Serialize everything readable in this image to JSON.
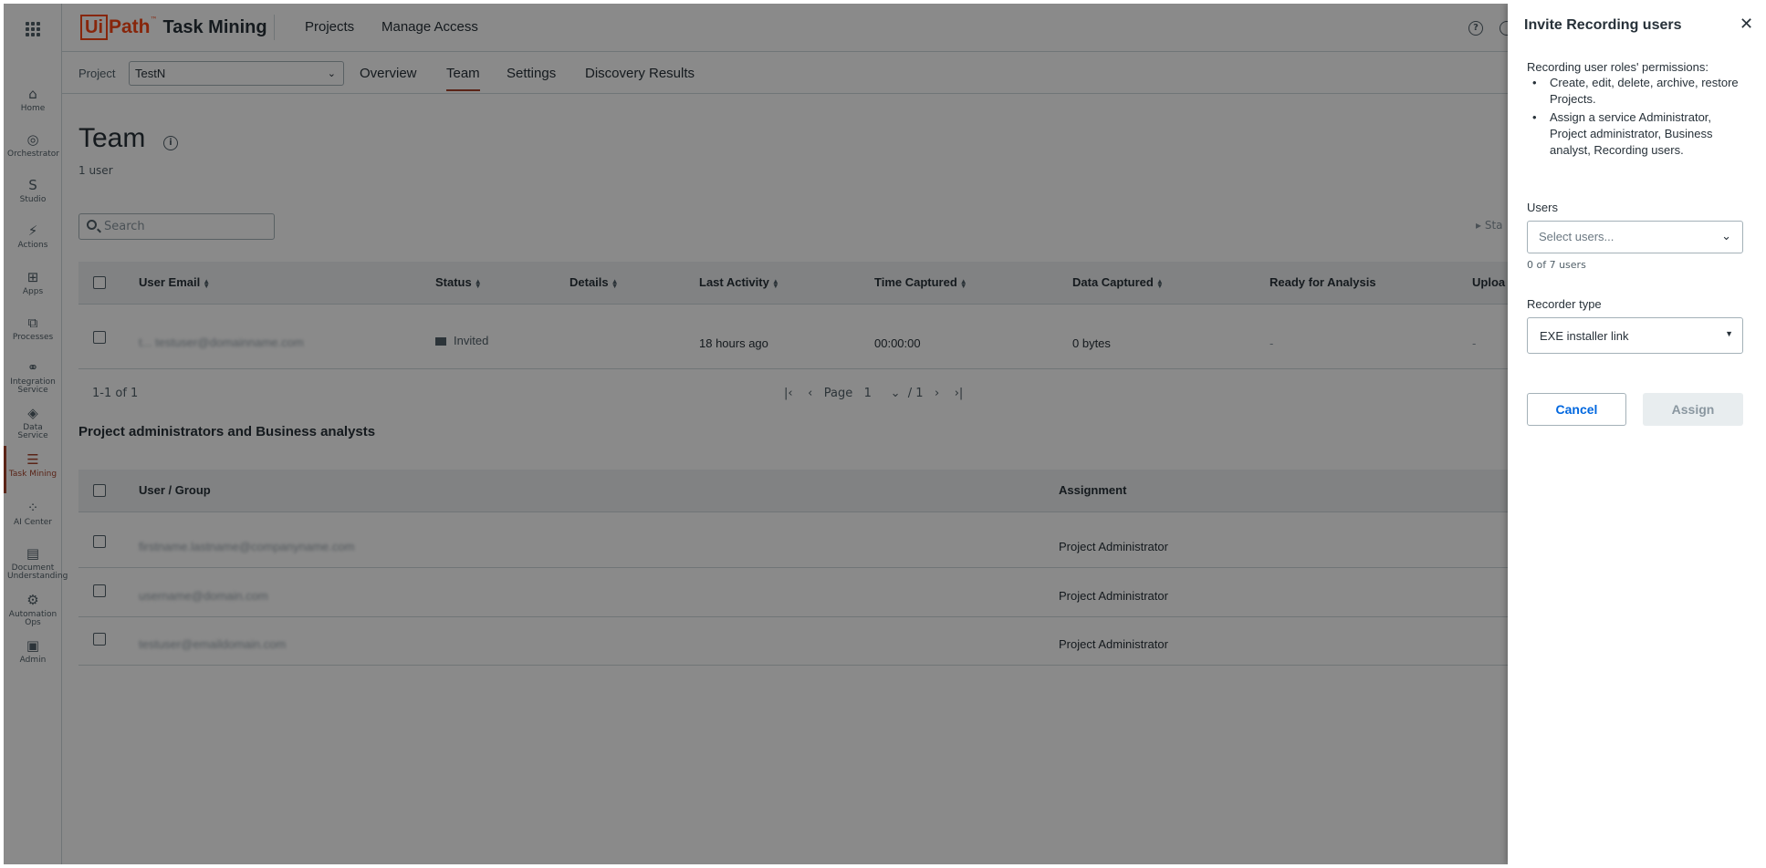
{
  "rail": {
    "items": [
      {
        "label": "Home",
        "icon": "home-icon"
      },
      {
        "label": "Orchestrator",
        "icon": "orchestrator-icon"
      },
      {
        "label": "Studio",
        "icon": "studio-icon"
      },
      {
        "label": "Actions",
        "icon": "actions-icon"
      },
      {
        "label": "Apps",
        "icon": "apps-icon"
      },
      {
        "label": "Processes",
        "icon": "processes-icon"
      },
      {
        "label": "Integration Service",
        "icon": "integration-service-icon"
      },
      {
        "label": "Data Service",
        "icon": "data-service-icon"
      },
      {
        "label": "Task Mining",
        "icon": "task-mining-icon"
      },
      {
        "label": "AI Center",
        "icon": "ai-center-icon"
      },
      {
        "label": "Document Understanding",
        "icon": "document-understanding-icon"
      },
      {
        "label": "Automation Ops",
        "icon": "automation-ops-icon"
      },
      {
        "label": "Admin",
        "icon": "admin-icon"
      }
    ],
    "active_color": "#a6432c"
  },
  "header": {
    "logo_ui": "Ui",
    "logo_path": "Path",
    "logo_tm": "™",
    "product": "Task Mining",
    "nav": [
      "Projects",
      "Manage Access"
    ],
    "help_glyph": "?"
  },
  "subheader": {
    "project_label": "Project",
    "project_value": "TestN",
    "tabs": [
      "Overview",
      "Team",
      "Settings",
      "Discovery Results"
    ],
    "active_tab": "Team"
  },
  "page": {
    "title": "Team",
    "user_count": "1 user",
    "search_placeholder": "Search",
    "status_truncated": "Sta"
  },
  "recording_table": {
    "columns": [
      "User Email",
      "Status",
      "Details",
      "Last Activity",
      "Time Captured",
      "Data Captured",
      "Ready for Analysis",
      "Uploa"
    ],
    "rows": [
      {
        "email": "t... testuser@domainname.com",
        "status": "Invited",
        "details": "",
        "last_activity": "18 hours ago",
        "time_captured": "00:00:00",
        "data_captured": "0 bytes",
        "ready": "-",
        "upload": "-"
      }
    ],
    "range": "1-1 of 1",
    "page_label": "Page",
    "page_value": "1",
    "page_total": "/ 1"
  },
  "admins_section": {
    "title": "Project administrators and Business analysts",
    "columns": [
      "User / Group",
      "Assignment"
    ],
    "rows": [
      {
        "user": "firstname.lastname@companyname.com",
        "assignment": "Project Administrator"
      },
      {
        "user": "username@domain.com",
        "assignment": "Project Administrator"
      },
      {
        "user": "testuser@emaildomain.com",
        "assignment": "Project Administrator"
      }
    ]
  },
  "drawer": {
    "title": "Invite Recording users",
    "close_glyph": "✕",
    "permissions_heading": "Recording user roles' permissions:",
    "permissions": [
      "Create, edit, delete, archive, restore Projects.",
      "Assign a service Administrator, Project administrator, Business analyst, Recording users."
    ],
    "users_label": "Users",
    "users_placeholder": "Select users...",
    "users_hint": "0 of 7 users",
    "recorder_label": "Recorder type",
    "recorder_value": "EXE installer link",
    "cancel_label": "Cancel",
    "assign_label": "Assign",
    "link_color": "#0067df"
  }
}
